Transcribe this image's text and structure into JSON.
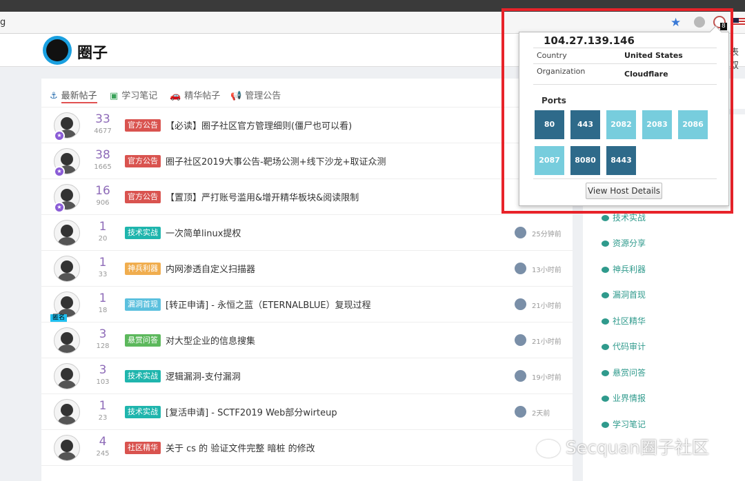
{
  "browser": {
    "url_fragment": "g",
    "extension_badge": "8"
  },
  "site": {
    "logo_text": "圈子",
    "header_cut": "表双"
  },
  "tabs": [
    {
      "icon": "⚓",
      "label": "最新帖子",
      "active": true
    },
    {
      "icon": "▣",
      "label": "学习笔记"
    },
    {
      "icon": "🚗",
      "label": "精华帖子"
    },
    {
      "icon": "📢",
      "label": "管理公告"
    }
  ],
  "posts": [
    {
      "replies": "33",
      "views": "4677",
      "tag": "官方公告",
      "tag_color": "#d9534f",
      "title": "【必读】圈子社区官方管理细则(僵尸也可以看)",
      "time": "",
      "vip": true
    },
    {
      "replies": "38",
      "views": "1665",
      "tag": "官方公告",
      "tag_color": "#d9534f",
      "title": "圈子社区2019大事公告-靶场公测+线下沙龙+取证众测",
      "time": "",
      "vip": true
    },
    {
      "replies": "16",
      "views": "906",
      "tag": "官方公告",
      "tag_color": "#d9534f",
      "title": "【置顶】严打账号滥用&增开精华板块&阅读限制",
      "time": "",
      "vip": true
    },
    {
      "replies": "1",
      "views": "20",
      "tag": "技术实战",
      "tag_color": "#1fb5ad",
      "title": "一次简单linux提权",
      "time": "25分钟前"
    },
    {
      "replies": "1",
      "views": "33",
      "tag": "神兵利器",
      "tag_color": "#f0ad4e",
      "title": "内网渗透自定义扫描器",
      "time": "13小时前"
    },
    {
      "replies": "1",
      "views": "18",
      "tag": "漏洞首现",
      "tag_color": "#5bc0de",
      "title": "[转正申请] - 永恒之蓝（ETERNALBLUE）复现过程",
      "time": "21小时前",
      "anon": "匿名"
    },
    {
      "replies": "3",
      "views": "128",
      "tag": "悬赏问答",
      "tag_color": "#5cb85c",
      "title": "对大型企业的信息搜集",
      "time": "21小时前"
    },
    {
      "replies": "3",
      "views": "103",
      "tag": "技术实战",
      "tag_color": "#1fb5ad",
      "title": "逻辑漏洞-支付漏洞",
      "time": "19小时前"
    },
    {
      "replies": "1",
      "views": "23",
      "tag": "技术实战",
      "tag_color": "#1fb5ad",
      "title": "[复活申请] - SCTF2019 Web部分wirteup",
      "time": "2天前"
    },
    {
      "replies": "4",
      "views": "245",
      "tag": "社区精华",
      "tag_color": "#d9534f",
      "title": "关于 cs 的 验证文件完整 暗桩 的修改",
      "time": ""
    }
  ],
  "sidebar": {
    "items": [
      "官方公告",
      "技术实战",
      "资源分享",
      "神兵利器",
      "漏洞首现",
      "社区精华",
      "代码审计",
      "悬赏问答",
      "业界情报",
      "学习笔记"
    ]
  },
  "popup": {
    "ip": "104.27.139.146",
    "country_label": "Country",
    "country": "United States",
    "org_label": "Organization",
    "org": "Cloudflare",
    "ports_label": "Ports",
    "ports": [
      {
        "port": "80",
        "style": "dark"
      },
      {
        "port": "443",
        "style": "dark"
      },
      {
        "port": "2082",
        "style": "light"
      },
      {
        "port": "2083",
        "style": "light"
      },
      {
        "port": "2086",
        "style": "light"
      },
      {
        "port": "2087",
        "style": "light"
      },
      {
        "port": "8080",
        "style": "dark"
      },
      {
        "port": "8443",
        "style": "dark"
      }
    ],
    "button_label": "View Host Details"
  },
  "watermark": "Secquan圈子社区"
}
